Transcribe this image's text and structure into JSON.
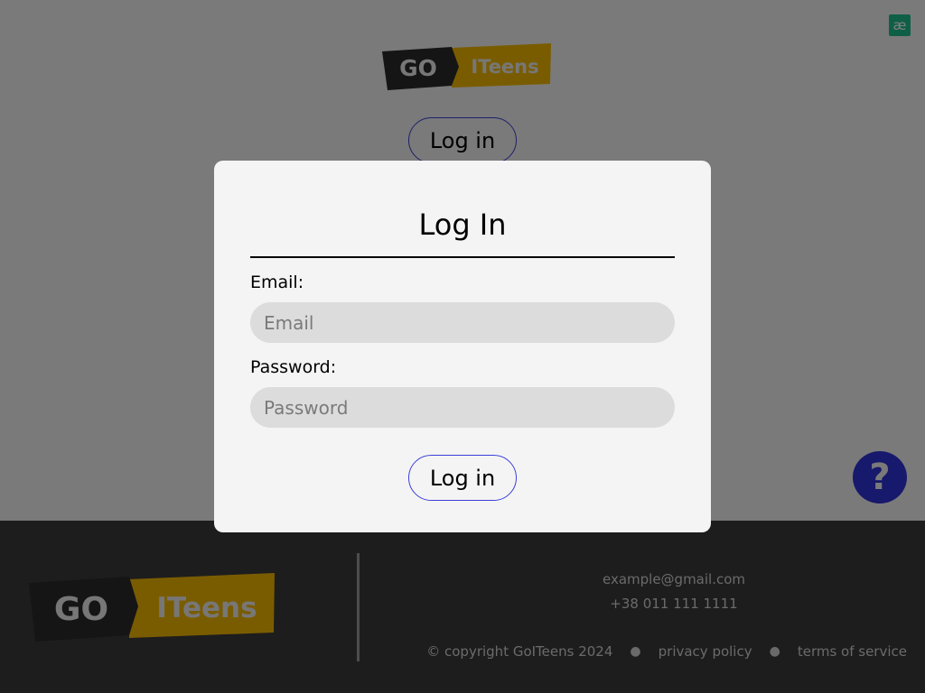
{
  "header": {
    "logo_left": "GO",
    "logo_right": "ITeens",
    "login_label": "Log in"
  },
  "extension_badge": "æ",
  "help_button": "?",
  "modal": {
    "title": "Log In",
    "email_label": "Email:",
    "email_placeholder": "Email",
    "email_value": "",
    "password_label": "Password:",
    "password_placeholder": "Password",
    "password_value": "",
    "submit_label": "Log in"
  },
  "footer": {
    "logo_left": "GO",
    "logo_right": "ITeens",
    "email": "example@gmail.com",
    "phone": "+38 011 111 1111",
    "copyright": "© copyright GoITeens 2024",
    "privacy": "privacy policy",
    "terms": "terms of service"
  },
  "colors": {
    "accent": "#2f33d8",
    "logo_yellow": "#f5b800",
    "logo_dark": "#2b2b2b",
    "badge_green": "#1fbf8f",
    "footer_bg": "#3a3a3a"
  },
  "icons": {
    "help": "question-mark-icon",
    "extension": "ae-ligature-icon"
  }
}
